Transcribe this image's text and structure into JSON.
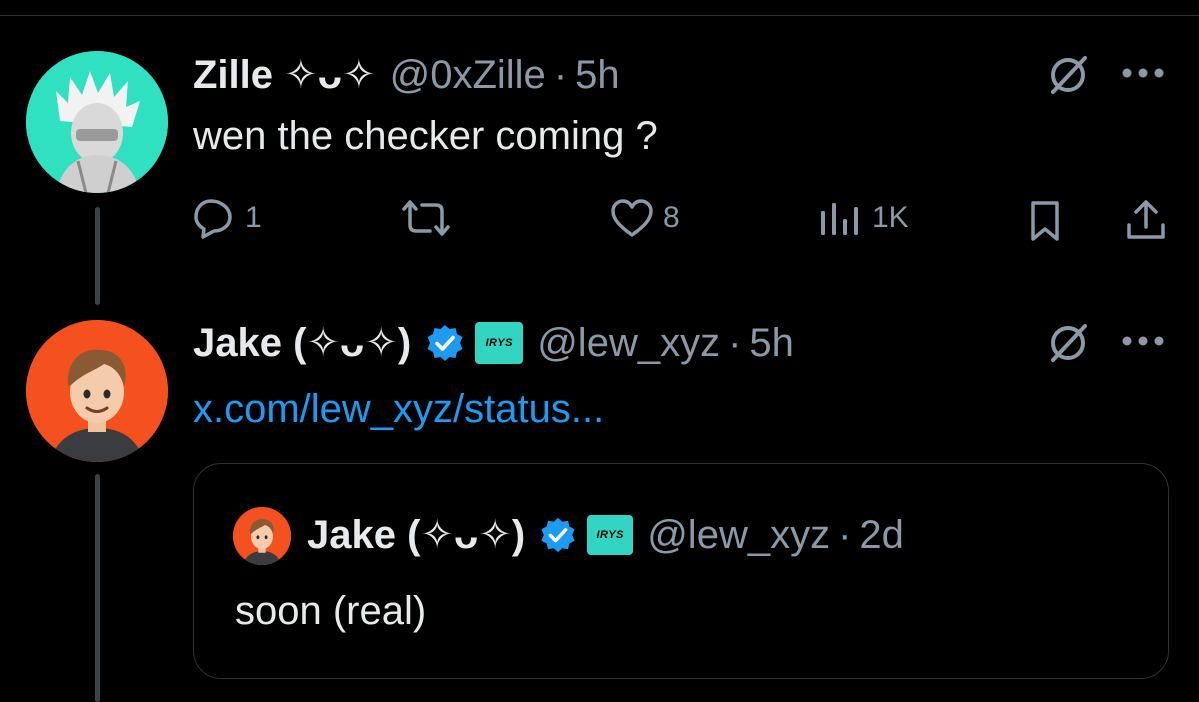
{
  "reply": {
    "name": "Zille ✧ᴗ✧",
    "handle": "@0xZille",
    "dot": "·",
    "time": "5h",
    "text": "wen the checker coming ?",
    "actions": {
      "replies": "1",
      "reposts": "",
      "likes": "8",
      "views": "1K"
    }
  },
  "post": {
    "name": "Jake (✧ᴗ✧)",
    "brand_label": "IRYS",
    "handle": "@lew_xyz",
    "dot": "·",
    "time": "5h",
    "link": "x.com/lew_xyz/status..."
  },
  "quote": {
    "name": "Jake (✧ᴗ✧)",
    "brand_label": "IRYS",
    "handle": "@lew_xyz",
    "dot": "·",
    "time": "2d",
    "text": "soon (real)"
  },
  "colors": {
    "background": "#000000",
    "text_primary": "#e7e9ea",
    "text_secondary": "#8b98a5",
    "link": "#1d9bf0",
    "verified": "#1d9bf0",
    "brand_badge": "#31d5c2",
    "avatar_zille_bg": "#2fe0c1",
    "avatar_jake_bg": "#f4511e"
  },
  "icons": {
    "reply": "comment-bubble",
    "repost": "repost-arrows",
    "like": "heart",
    "views": "bar-chart",
    "bookmark": "bookmark",
    "share": "share-upload",
    "grok": "grok-slash-circle",
    "more": "ellipsis"
  }
}
